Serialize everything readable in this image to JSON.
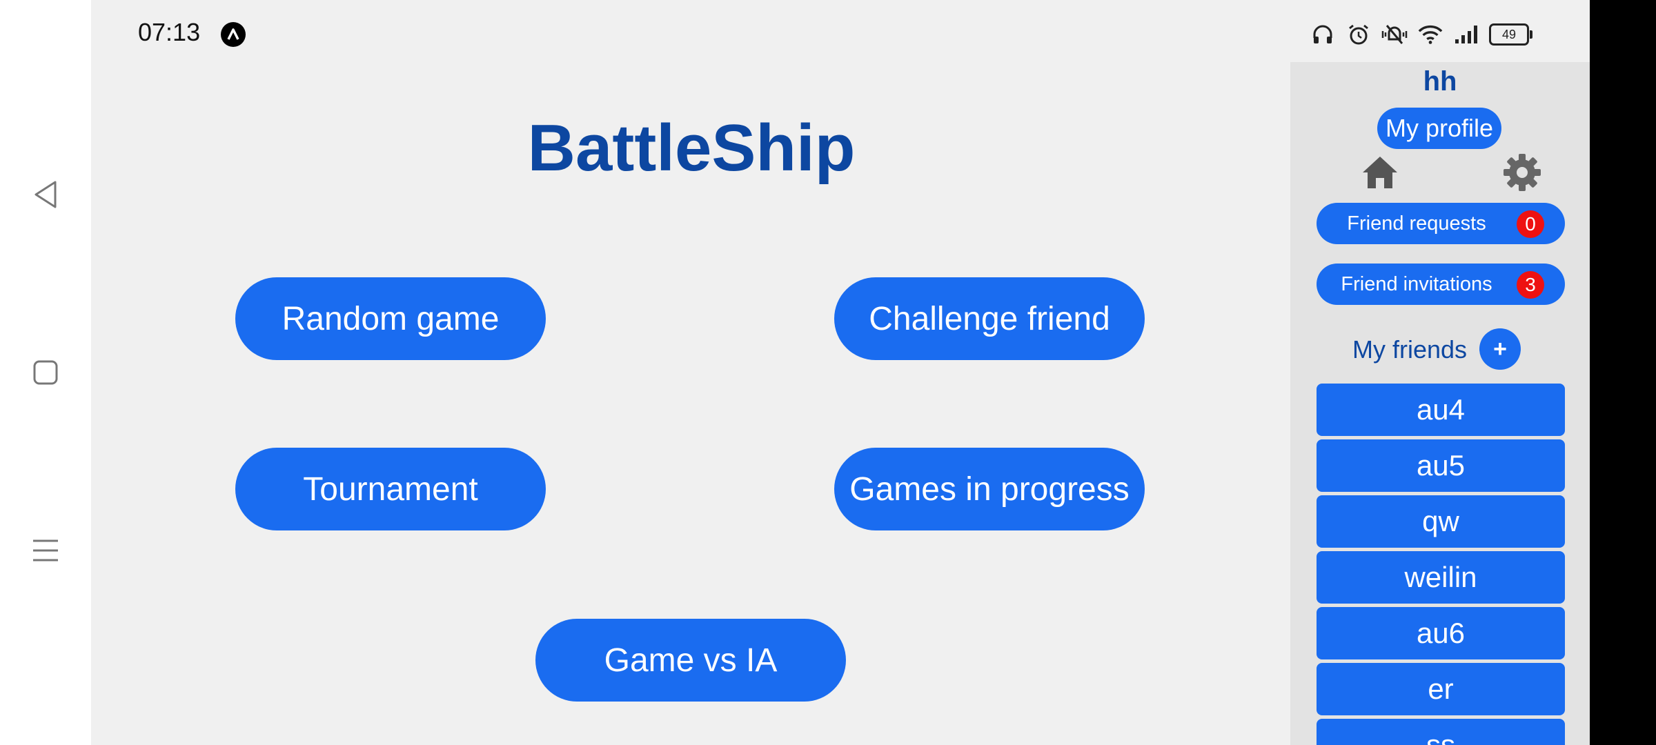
{
  "status_bar": {
    "time": "07:13",
    "battery": "49",
    "icons": [
      "headphones-icon",
      "alarm-icon",
      "vibrate-icon",
      "wifi-icon",
      "signal-icon"
    ]
  },
  "app": {
    "title": "BattleShip",
    "buttons": {
      "random_game": "Random game",
      "challenge_friend": "Challenge friend",
      "tournament": "Tournament",
      "games_in_progress": "Games in progress",
      "game_vs_ia": "Game vs IA"
    }
  },
  "sidebar": {
    "username": "hh",
    "profile_label": "My profile",
    "friend_requests": {
      "label": "Friend requests",
      "count": "0"
    },
    "friend_invitations": {
      "label": "Friend invitations",
      "count": "3"
    },
    "friends_label": "My friends",
    "add_label": "+",
    "friends": [
      "au4",
      "au5",
      "qw",
      "weilin",
      "au6",
      "er",
      "ss"
    ]
  },
  "colors": {
    "primary": "#1a6cf0",
    "title": "#0d47a1",
    "badge": "#ee1111",
    "background": "#f0f0f0",
    "sidebar": "#e3e3e3"
  }
}
